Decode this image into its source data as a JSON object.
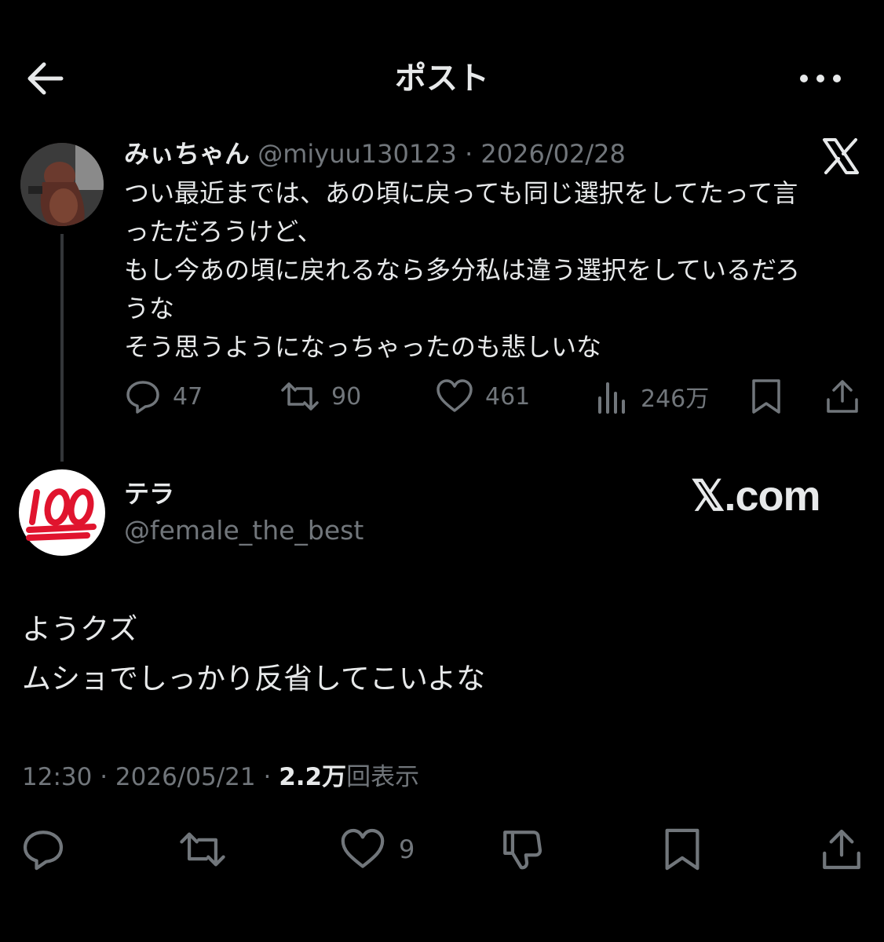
{
  "header": {
    "title": "ポスト"
  },
  "quoted_post": {
    "display_name": "みぃちゃん",
    "handle": "@miyuu130123",
    "separator": "·",
    "date": "2026/02/28",
    "text": "つい最近までは、あの頃に戻っても同じ選択をしてたって言\nっただろうけど、\nもし今あの頃に戻れるなら多分私は違う選択をしているだろ\nうな\nそう思うようになっちゃったのも悲しいな",
    "stats": {
      "replies": "47",
      "reposts": "90",
      "likes": "461",
      "views": "246万"
    },
    "icons": [
      "x-logo-icon",
      "reply-icon",
      "repost-icon",
      "like-icon",
      "views-icon",
      "bookmark-icon",
      "share-icon"
    ]
  },
  "main_post": {
    "display_name": "テラ",
    "handle": "@female_the_best",
    "avatar_emoji": "💯",
    "watermark": "𝕏.com",
    "text": "ようクズ\nムショでしっかり反省してこいよな",
    "time": "12:30",
    "sep1": "·",
    "date": "2026/05/21",
    "sep2": "·",
    "views_count": "2.2万",
    "views_label": "回表示",
    "likes": "9",
    "icons": [
      "reply-icon",
      "repost-icon",
      "like-icon",
      "dislike-icon",
      "bookmark-icon",
      "share-icon"
    ]
  },
  "colors": {
    "background": "#000000",
    "text_primary": "#e7e9ea",
    "text_secondary": "#71767b",
    "thread_line": "#333639",
    "badge_red": "#e0142e"
  }
}
